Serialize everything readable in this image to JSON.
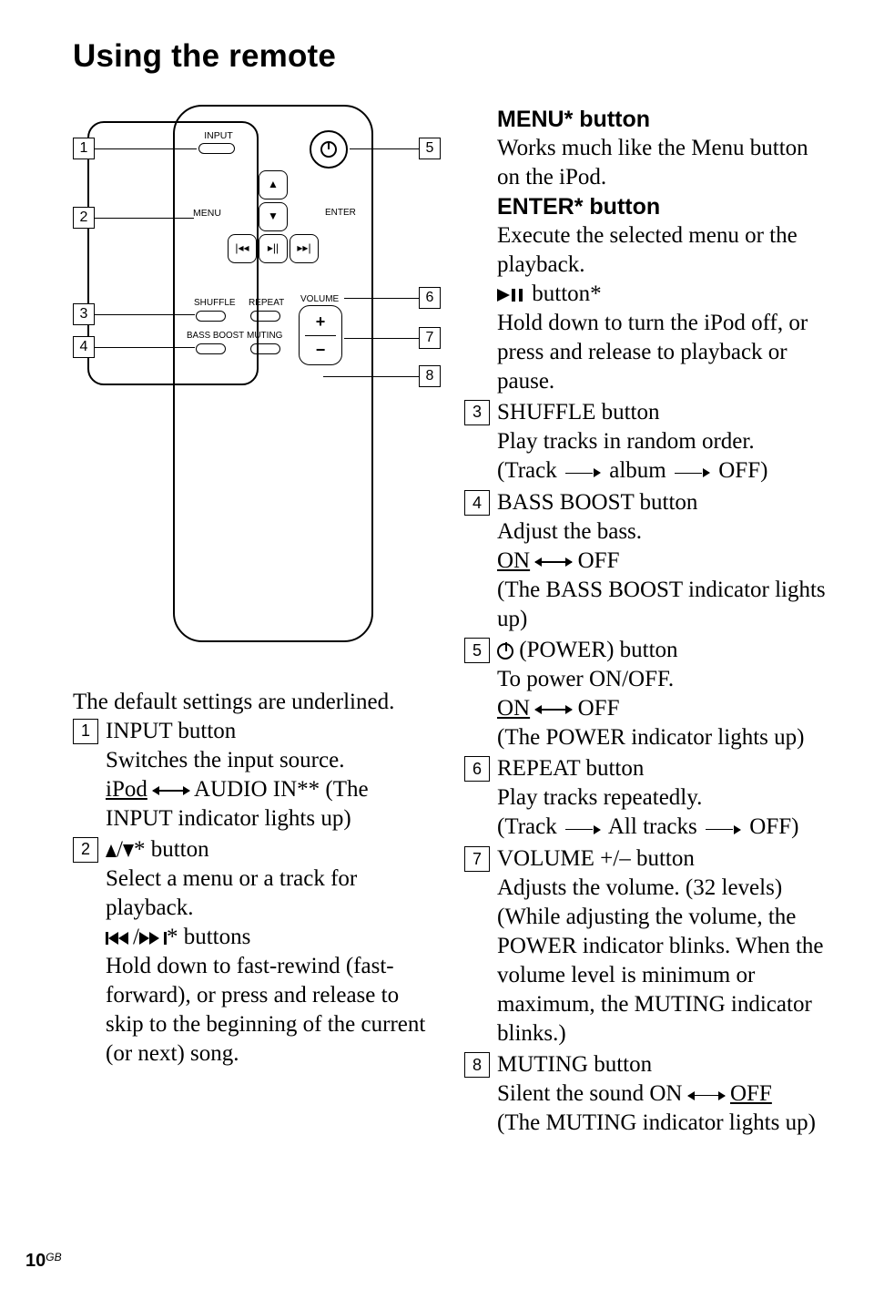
{
  "title": "Using the remote",
  "remote": {
    "input_label": "INPUT",
    "menu_label": "MENU",
    "enter_label": "ENTER",
    "shuffle_label": "SHUFFLE",
    "repeat_label": "REPEAT",
    "volume_label": "VOLUME",
    "bass_boost_label": "BASS BOOST",
    "muting_label": "MUTING"
  },
  "callouts": {
    "1": "1",
    "2": "2",
    "3": "3",
    "4": "4",
    "5": "5",
    "6": "6",
    "7": "7",
    "8": "8"
  },
  "left_intro": "The default settings are underlined.",
  "items": {
    "i1": {
      "head": "INPUT button",
      "line1": "Switches the input source.",
      "ipod": "iPod",
      "audioin": " AUDIO IN** (The INPUT indicator lights up)"
    },
    "i2": {
      "btn_suffix": "* button",
      "line1": "Select a menu or a track for playback.",
      "btns_suffix": "* buttons",
      "line2": "Hold down to fast-rewind (fast-forward), or press and release to skip to the beginning of the current (or next) song.",
      "menu_head": "MENU* button",
      "menu_body": "Works much like the Menu button on the iPod.",
      "enter_head": "ENTER* button",
      "enter_body": "Execute the selected menu or the playback.",
      "playpause_suffix": " button*",
      "playpause_body": "Hold down to turn the iPod off, or press and release to playback or pause."
    },
    "i3": {
      "head": "SHUFFLE button",
      "body": "Play tracks in random order.",
      "track": "(Track",
      "album": " album",
      "off": " OFF)"
    },
    "i4": {
      "head": "BASS BOOST button",
      "body": "Adjust the bass.",
      "on": "ON",
      "off": " OFF",
      "note": "(The BASS BOOST indicator lights up)"
    },
    "i5": {
      "head": " (POWER) button",
      "body": "To power ON/OFF.",
      "on": "ON",
      "off": " OFF",
      "note": "(The POWER indicator lights up)"
    },
    "i6": {
      "head": "REPEAT button",
      "body": "Play tracks repeatedly.",
      "track": "(Track",
      "all": " All tracks",
      "off": " OFF)"
    },
    "i7": {
      "head": "VOLUME +/– button",
      "body": "Adjusts the volume. (32 levels) (While adjusting the volume, the POWER indicator blinks. When the volume level is minimum or maximum, the MUTING indicator blinks.)"
    },
    "i8": {
      "head": "MUTING button",
      "body_pre": "Silent the sound ON",
      "off": " OFF",
      "note": "(The MUTING indicator lights up)"
    }
  },
  "footer_page": "10",
  "footer_region": "GB"
}
